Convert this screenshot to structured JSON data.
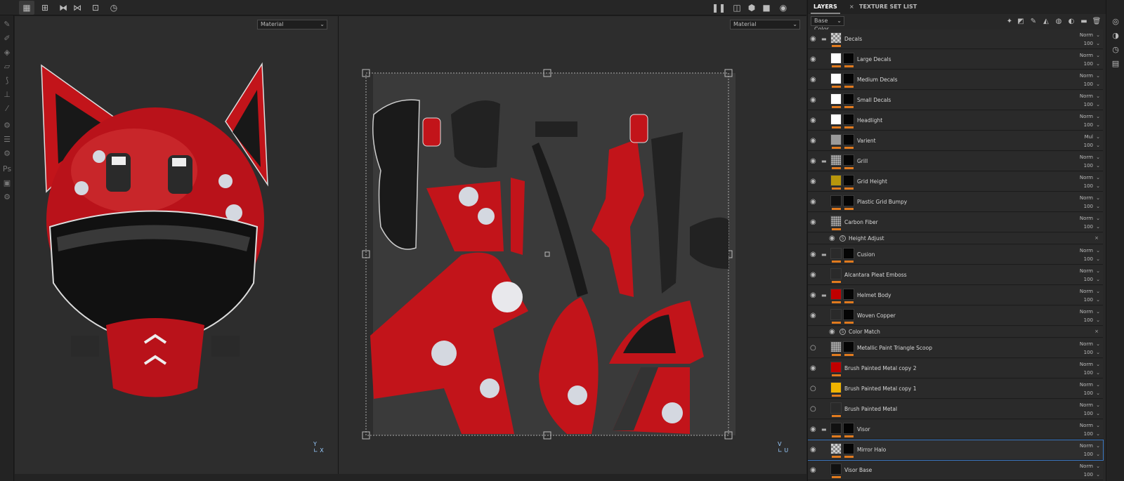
{
  "viewport_left": {
    "dropdown": "Material"
  },
  "viewport_right": {
    "dropdown": "Material"
  },
  "toolbar_icons": [
    "grid-icon",
    "grid-2-icon",
    "mirror-icon",
    "align-icon",
    "add-icon",
    "history-icon"
  ],
  "panel": {
    "tabs": [
      {
        "label": "LAYERS"
      },
      {
        "label": "TEXTURE SET LIST"
      }
    ],
    "tab_close": "×",
    "channel": "Base Color"
  },
  "layers": [
    {
      "name": "Decals",
      "folder": true,
      "visible": true,
      "blend": "Norm",
      "opacity": "100",
      "c1": "#cfcfcf",
      "c2": null,
      "pattern": "checker"
    },
    {
      "name": "Large Decals",
      "folder": false,
      "visible": true,
      "blend": "Norm",
      "opacity": "100",
      "c1": "#ffffff",
      "c2": "#050505"
    },
    {
      "name": "Medium Decals",
      "folder": false,
      "visible": true,
      "blend": "Norm",
      "opacity": "100",
      "c1": "#ffffff",
      "c2": "#050505"
    },
    {
      "name": "Small Decals",
      "folder": false,
      "visible": true,
      "blend": "Norm",
      "opacity": "100",
      "c1": "#ffffff",
      "c2": "#050505"
    },
    {
      "name": "Headlight",
      "folder": false,
      "visible": true,
      "blend": "Norm",
      "opacity": "100",
      "c1": "#ffffff",
      "c2": "#050505"
    },
    {
      "name": "Varient",
      "folder": false,
      "visible": true,
      "blend": "Mul",
      "opacity": "100",
      "c1": "#9a9a9a",
      "c2": "#050505"
    },
    {
      "name": "Grill",
      "folder": true,
      "visible": true,
      "blend": "Norm",
      "opacity": "100",
      "c1": "#777777",
      "c2": "#050505",
      "pattern": "noise"
    },
    {
      "name": "Grid Height",
      "folder": false,
      "visible": true,
      "blend": "Norm",
      "opacity": "100",
      "c1": "#b8960c",
      "c2": "#050505"
    },
    {
      "name": "Plastic Grid Bumpy",
      "folder": false,
      "visible": true,
      "blend": "Norm",
      "opacity": "100",
      "c1": "#111111",
      "c2": "#050505"
    },
    {
      "name": "Carbon Fiber",
      "folder": false,
      "visible": true,
      "blend": "Norm",
      "opacity": "100",
      "c1": "#666666",
      "c2": null,
      "pattern": "noise"
    },
    {
      "name": "Height Adjust",
      "effect": true,
      "visible": true
    },
    {
      "name": "Cusion",
      "folder": true,
      "visible": true,
      "blend": "Norm",
      "opacity": "100",
      "c1": "#2a2a2a",
      "c2": "#050505"
    },
    {
      "name": "Alcantara Pleat Emboss",
      "folder": false,
      "visible": true,
      "blend": "Norm",
      "opacity": "100",
      "c1": "#2a2a2a",
      "c2": null
    },
    {
      "name": "Helmet Body",
      "folder": true,
      "visible": true,
      "blend": "Norm",
      "opacity": "100",
      "c1": "#c00000",
      "c2": "#050505"
    },
    {
      "name": "Woven Copper",
      "folder": false,
      "visible": true,
      "blend": "Norm",
      "opacity": "100",
      "c1": "#2a2a2a",
      "c2": "#050505"
    },
    {
      "name": "Color Match",
      "effect": true,
      "visible": true
    },
    {
      "name": "Metallic Paint Triangle Scoop",
      "folder": false,
      "visible": false,
      "blend": "Norm",
      "opacity": "100",
      "c1": "#777777",
      "c2": "#050505",
      "pattern": "noise"
    },
    {
      "name": "Brush Painted Metal copy 2",
      "folder": false,
      "visible": true,
      "blend": "Norm",
      "opacity": "100",
      "c1": "#c00000",
      "c2": null
    },
    {
      "name": "Brush Painted Metal copy 1",
      "folder": false,
      "visible": false,
      "blend": "Norm",
      "opacity": "100",
      "c1": "#f0b400",
      "c2": null
    },
    {
      "name": "Brush Painted Metal",
      "folder": false,
      "visible": false,
      "blend": "Norm",
      "opacity": "100",
      "c1": "#2a2a2a",
      "c2": null
    },
    {
      "name": "Visor",
      "folder": true,
      "visible": true,
      "blend": "Norm",
      "opacity": "100",
      "c1": "#111111",
      "c2": "#050505"
    },
    {
      "name": "Mirror Halo",
      "folder": false,
      "visible": true,
      "blend": "Norm",
      "opacity": "100",
      "c1": "#cfcfcf",
      "c2": "#050505",
      "pattern": "checker",
      "selected": true
    },
    {
      "name": "Visor Base",
      "folder": false,
      "visible": true,
      "blend": "Norm",
      "opacity": "100",
      "c1": "#111111",
      "c2": null
    }
  ]
}
